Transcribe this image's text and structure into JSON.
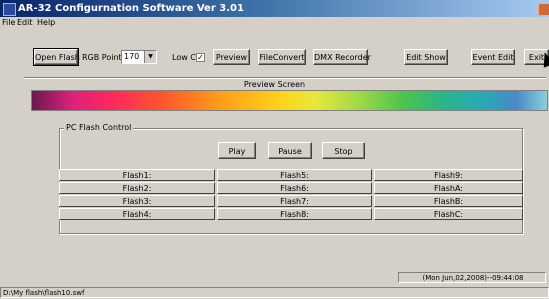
{
  "window": {
    "title": "AR-32 Configurnation Software Ver 3.01"
  },
  "menu": [
    "File",
    "Edit",
    "Help"
  ],
  "toolbar": {
    "open_flash": "Open Flash",
    "rgb_point_label": "RGB Point",
    "rgb_point_value": "170",
    "low_cut_label": "Low Cut",
    "low_cut_checked": "✓",
    "preview": "Preview",
    "file_convert": "FileConvert",
    "dmx_recorder": "DMX Recorder",
    "edit_show": "Edit Show",
    "event_edit": "Event Edit",
    "exit": "Exit"
  },
  "preview_screen": {
    "label": "Preview Screen"
  },
  "pc_flash_control": {
    "title": "PC Flash Control",
    "play": "Play",
    "pause": "Pause",
    "stop": "Stop",
    "flash_rows": [
      [
        "Flash1:",
        "Flash5:",
        "Flash9:"
      ],
      [
        "Flash2:",
        "Flash6:",
        "FlashA:"
      ],
      [
        "Flash3:",
        "Flash7:",
        "FlashB:"
      ],
      [
        "Flash4:",
        "Flash8:",
        "FlashC:"
      ]
    ]
  },
  "status": {
    "datetime": "(Mon Jun,02,2008)--09:44:08",
    "path": "D:\\My flash\\flash10.swf"
  }
}
